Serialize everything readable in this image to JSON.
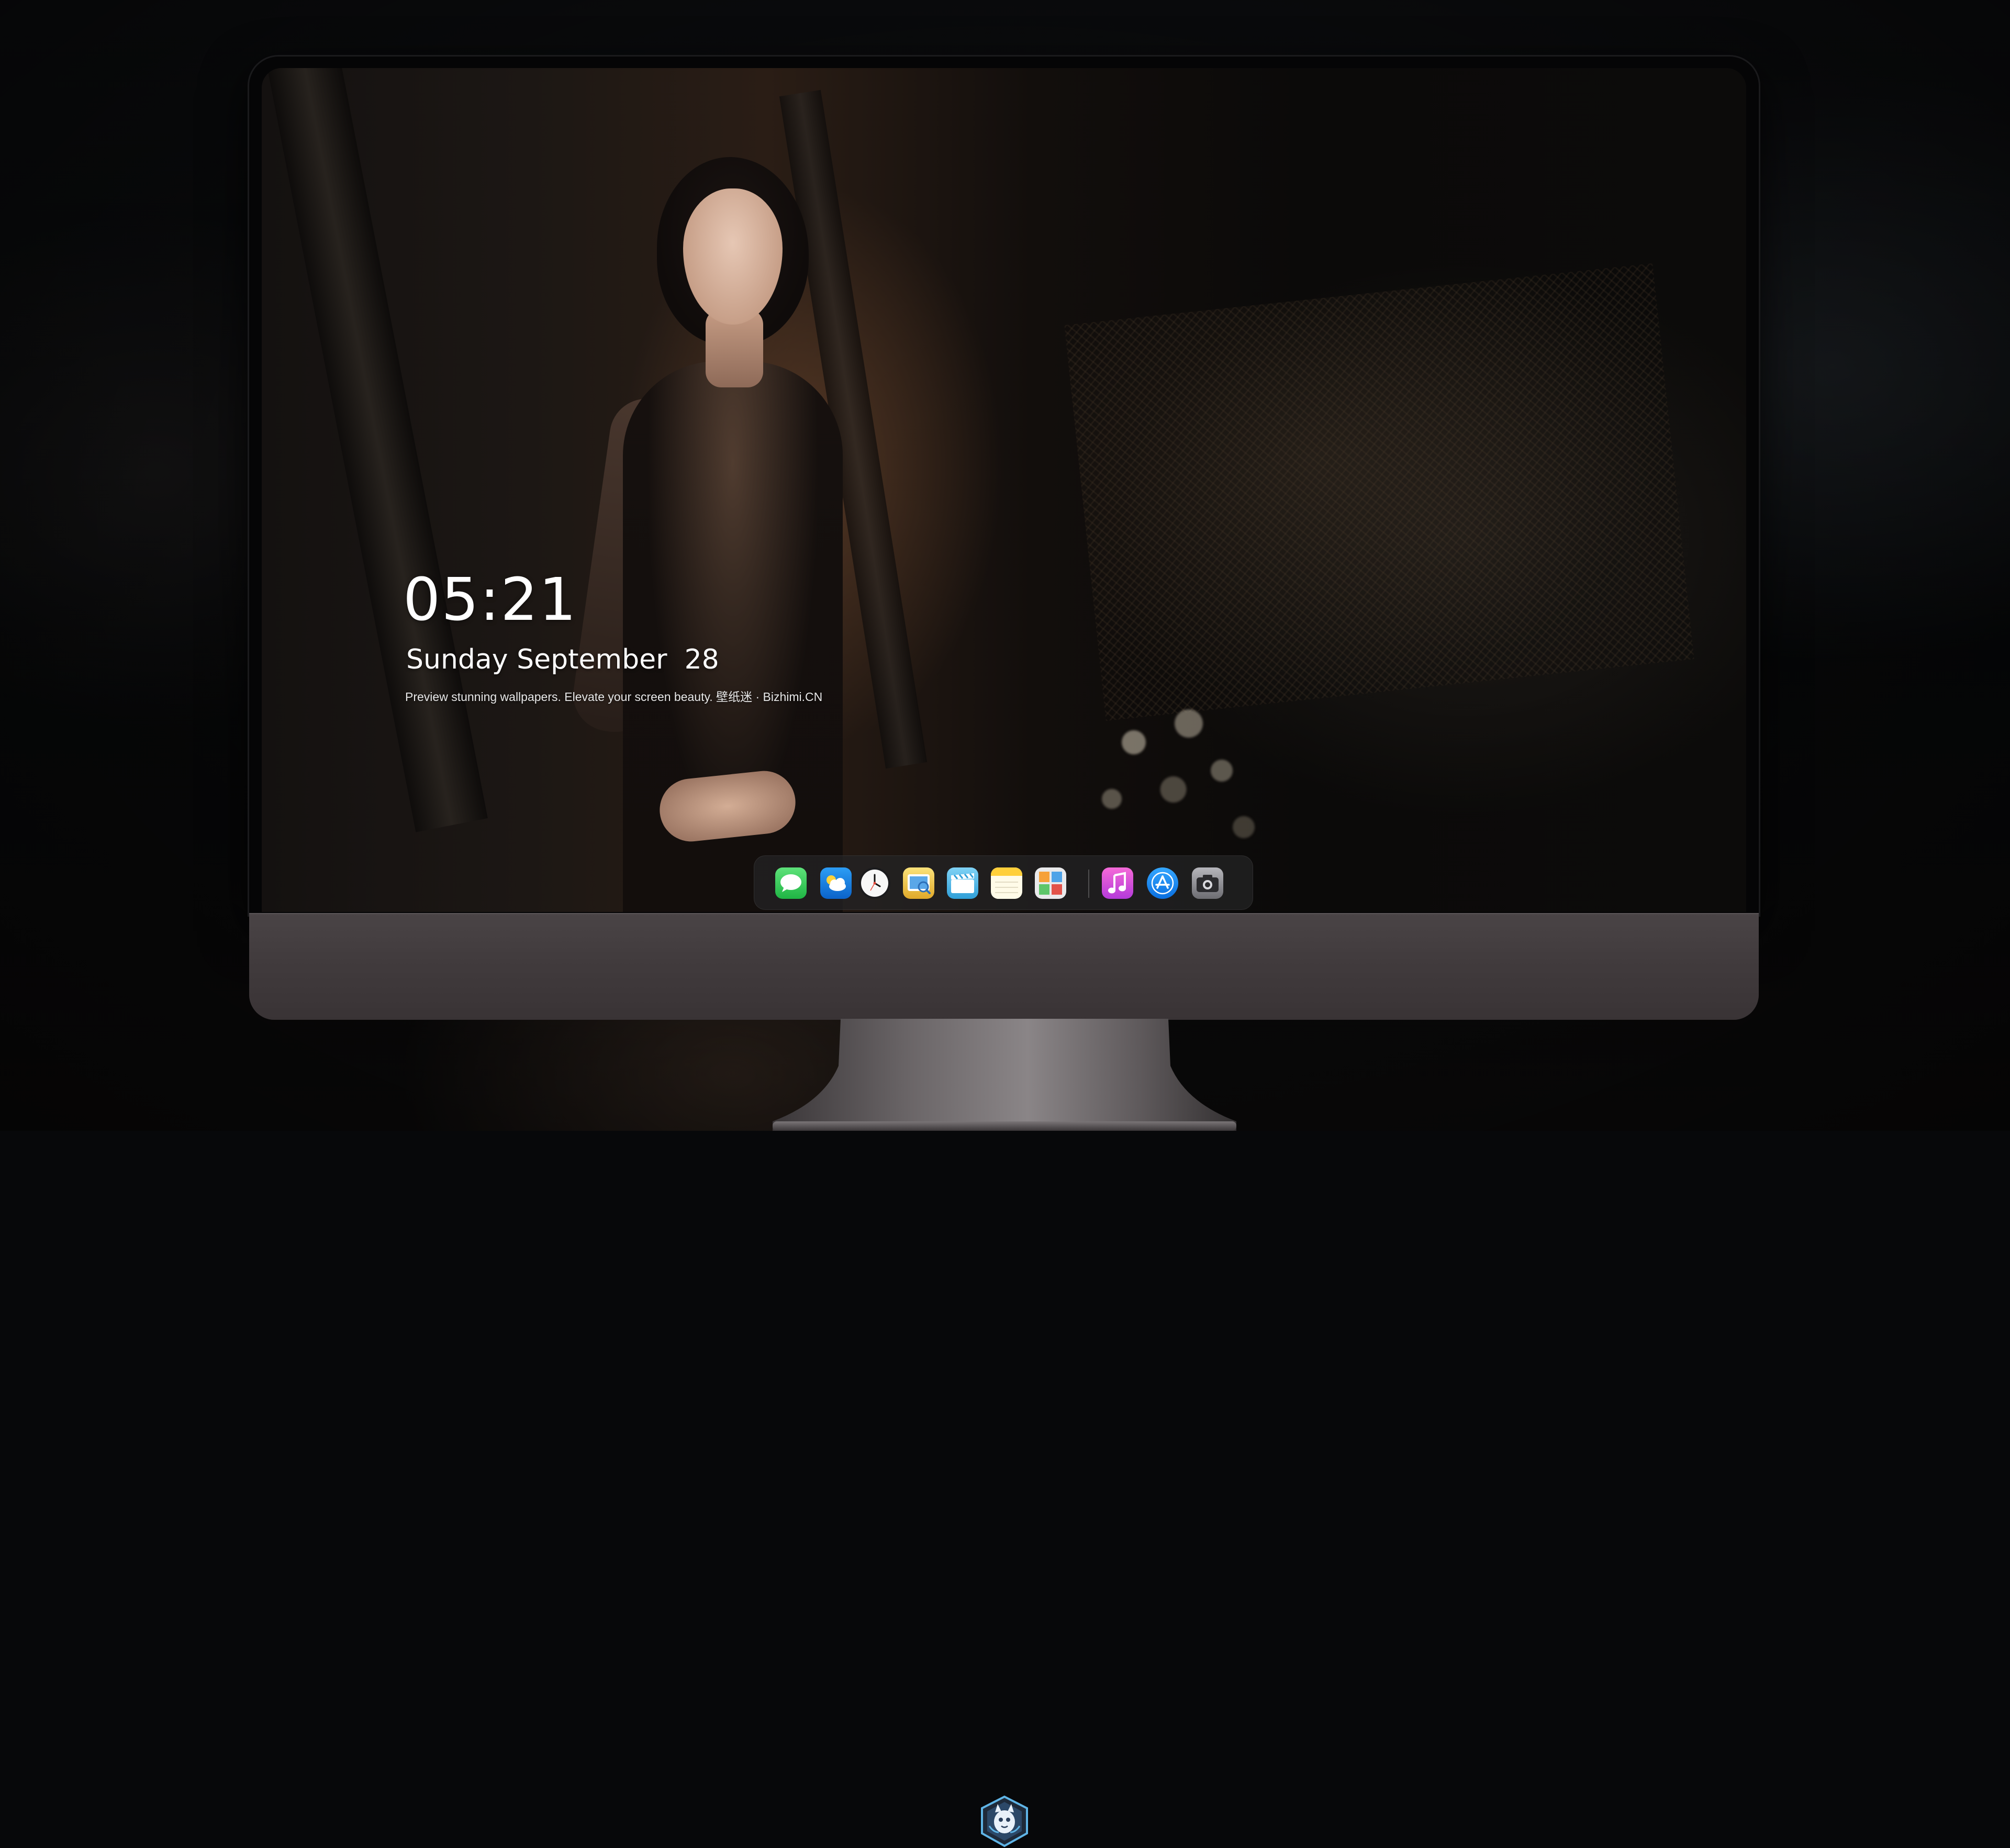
{
  "lock_screen": {
    "time": "05:21",
    "date": "Sunday September  28",
    "tagline": "Preview stunning wallpapers. Elevate your screen beauty. 壁纸迷 · Bizhimi.CN"
  },
  "dock": {
    "apps": [
      {
        "name": "messages",
        "icon": "speech-bubble-icon",
        "color": "#34c759"
      },
      {
        "name": "weather",
        "icon": "cloud-sun-icon",
        "color": "#1e8cf0"
      },
      {
        "name": "clock",
        "icon": "clock-icon",
        "color": "#f2f2f2"
      },
      {
        "name": "preview",
        "icon": "photo-viewer-icon",
        "color": "#f0c23c"
      },
      {
        "name": "clips",
        "icon": "clapperboard-icon",
        "color": "#4fb7e8"
      },
      {
        "name": "notes",
        "icon": "notes-icon",
        "color": "#ffd54a"
      },
      {
        "name": "photo-booth",
        "icon": "photo-grid-icon",
        "color": "#e8e8e8"
      },
      {
        "name": "music",
        "icon": "music-note-icon",
        "color": "#e44ad6"
      },
      {
        "name": "app-store",
        "icon": "app-store-icon",
        "color": "#1a8cff"
      },
      {
        "name": "camera",
        "icon": "camera-icon",
        "color": "#8e8e93"
      }
    ]
  },
  "brand": {
    "logo_icon": "mascot-logo-icon",
    "accent": "#5fb4e6"
  },
  "colors": {
    "monitor_chin": "#433d3f",
    "bezel": "#050506",
    "background": "#07080a"
  }
}
